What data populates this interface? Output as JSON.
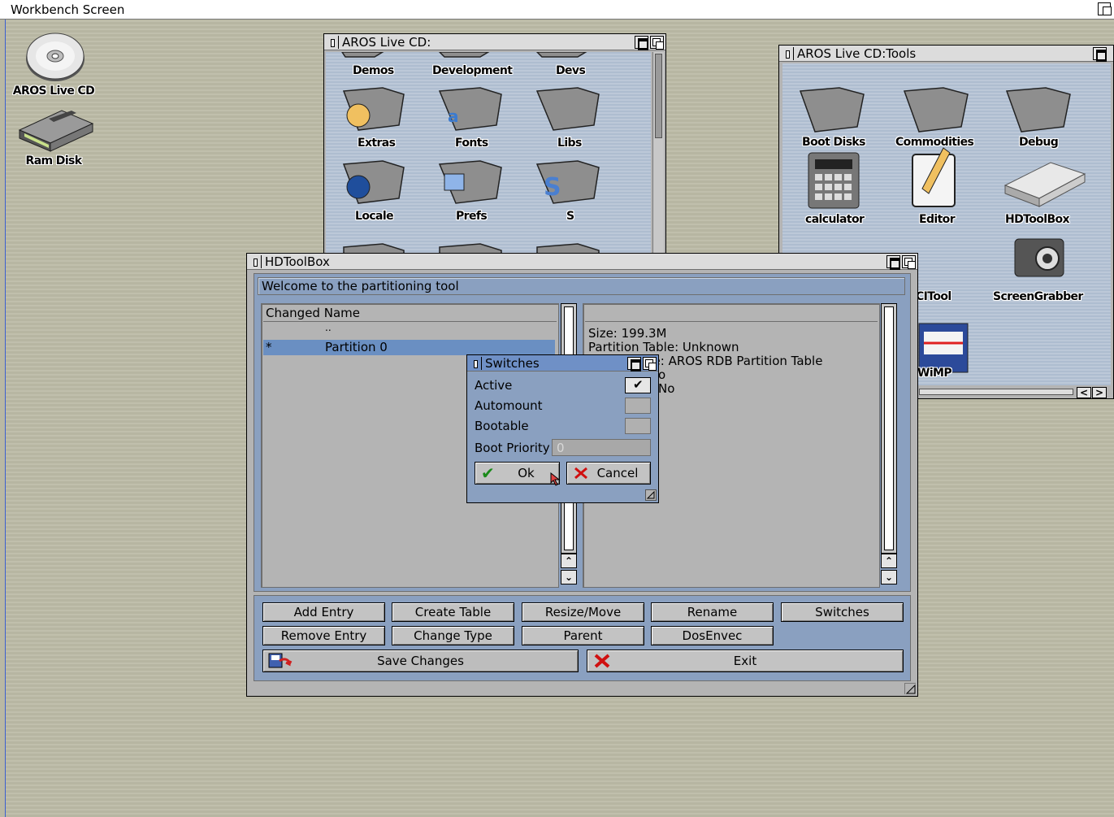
{
  "screen": {
    "title": "Workbench Screen"
  },
  "desktop_icons": [
    {
      "label": "AROS Live CD",
      "icon": "cd-disc-icon"
    },
    {
      "label": "Ram Disk",
      "icon": "ram-disk-icon"
    }
  ],
  "live_cd_window": {
    "title": "AROS Live CD:",
    "icons": [
      "Demos",
      "Development",
      "Devs",
      "Extras",
      "Fonts",
      "Libs",
      "Locale",
      "Prefs",
      "S"
    ]
  },
  "tools_window": {
    "title": "AROS Live CD:Tools",
    "icons": [
      "Boot Disks",
      "Commodities",
      "Debug",
      "calculator",
      "Editor",
      "HDToolBox",
      "PCITool",
      "ScreenGrabber",
      "WiMP"
    ],
    "partial_label": "CITool"
  },
  "hdtoolbox": {
    "title": "HDToolBox",
    "status": "Welcome to the partitioning tool",
    "list_header": "Changed Name",
    "list_items": [
      {
        "changed": "",
        "name": ".."
      },
      {
        "changed": "*",
        "name": "Partition 0"
      }
    ],
    "info_lines": [
      "Size: 199.3M",
      "Partition Table: Unknown",
      "Partition Type: AROS RDB Partition Table",
      "Active: No",
      "Bootable: No"
    ],
    "info_visible": [
      "Size: 199.3M",
      "Partition Table: Unknown",
      "be: AROS RDB Partition Table",
      "o",
      "No"
    ],
    "buttons_row1": [
      "Add Entry",
      "Create Table",
      "Resize/Move",
      "Rename",
      "Switches"
    ],
    "buttons_row2": [
      "Remove Entry",
      "Change Type",
      "Parent",
      "DosEnvec"
    ],
    "save_label": "Save Changes",
    "exit_label": "Exit"
  },
  "switches": {
    "title": "Switches",
    "active_label": "Active",
    "active_checked": true,
    "automount_label": "Automount",
    "automount_checked": false,
    "bootable_label": "Bootable",
    "bootable_checked": false,
    "boot_priority_label": "Boot Priority",
    "boot_priority_value": "0",
    "ok_label": "Ok",
    "cancel_label": "Cancel"
  },
  "colors": {
    "accent_blue": "#6f90c6",
    "selection": "#6a8fc2",
    "desktop": "#b9b8a4"
  }
}
